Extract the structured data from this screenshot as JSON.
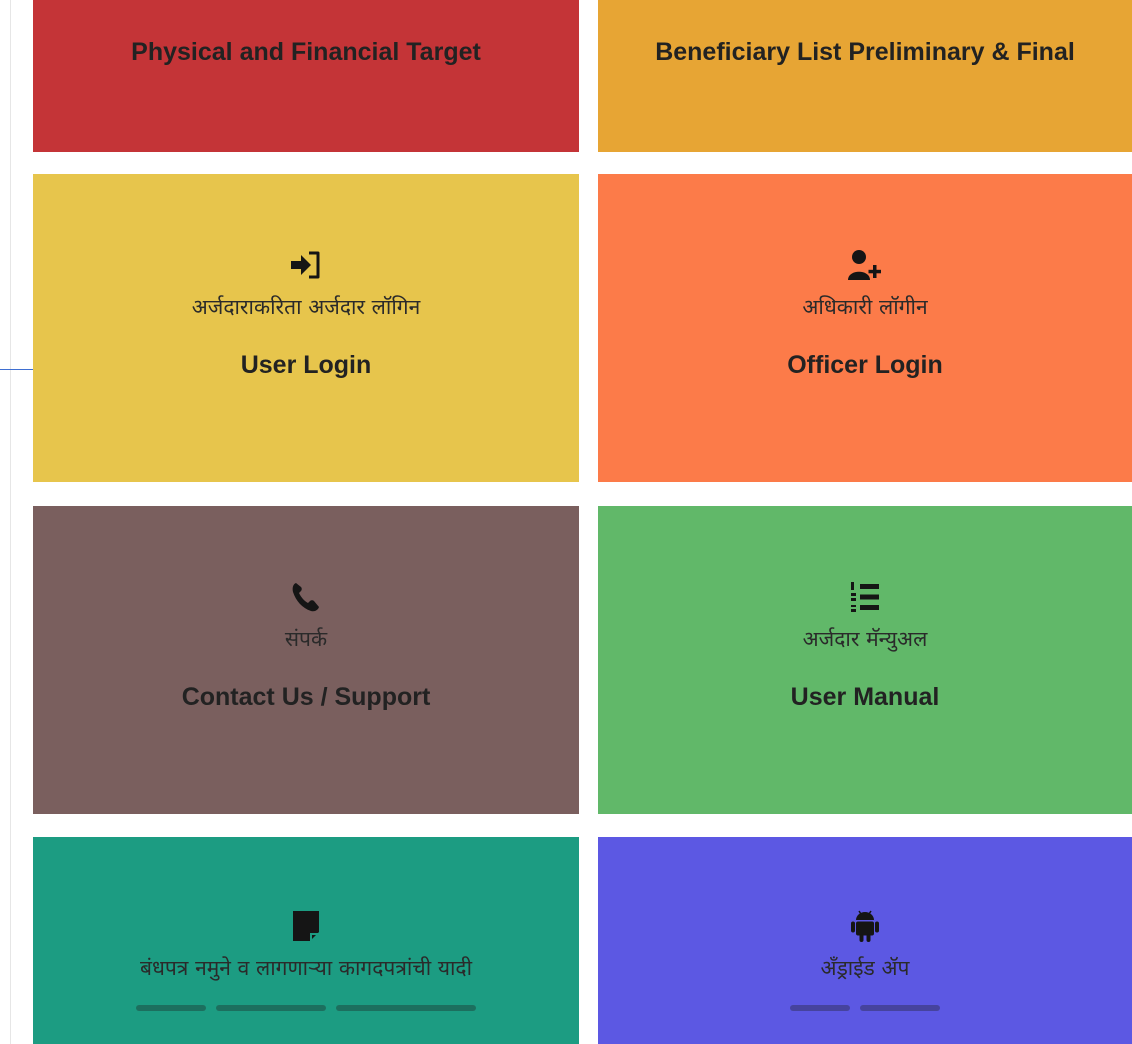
{
  "tiles": {
    "physical_target": {
      "label": "Physical and Financial Target",
      "color": "#c43437"
    },
    "beneficiary_list": {
      "label": "Beneficiary List Preliminary & Final",
      "color": "#e7a534"
    },
    "user_login": {
      "icon": "sign-in-icon",
      "marathi": "अर्जदाराकरिता अर्जदार लॉगिन",
      "english": "User Login",
      "color": "#e7c54c"
    },
    "officer_login": {
      "icon": "user-plus-icon",
      "marathi": "अधिकारी लॉगीन",
      "english": "Officer Login",
      "color": "#fc7b49"
    },
    "contact_support": {
      "icon": "phone-icon",
      "marathi": "संपर्क",
      "english": "Contact Us / Support",
      "color": "#7a5f5e"
    },
    "user_manual": {
      "icon": "ordered-list-icon",
      "marathi": "अर्जदार मॅन्युअल",
      "english": "User Manual",
      "color": "#61b869"
    },
    "bond_documents": {
      "icon": "document-icon",
      "marathi": "बंधपत्र नमुने व लागणाऱ्या कागदपत्रांची यादी",
      "color": "#1c9c82"
    },
    "android_app": {
      "icon": "android-icon",
      "marathi": "ॲंड्राईड ॲप",
      "color": "#5c58e3"
    }
  }
}
